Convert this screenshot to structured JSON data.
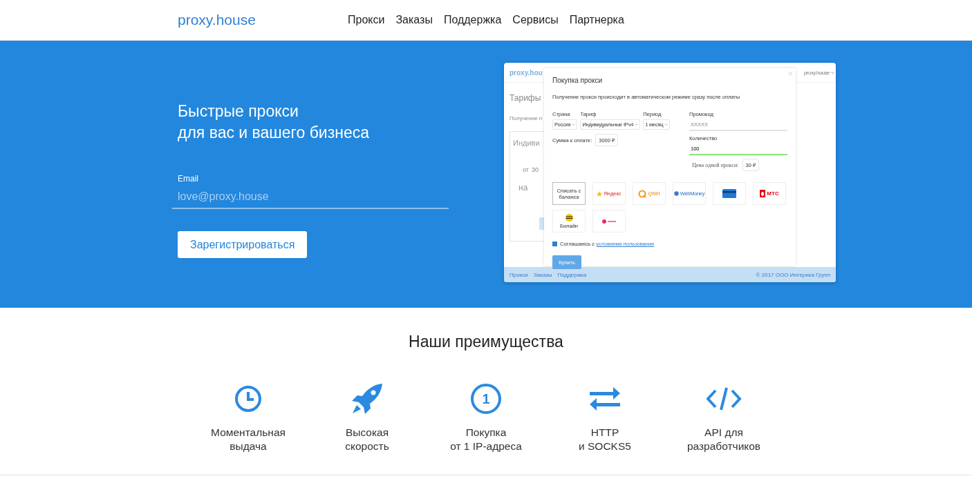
{
  "header": {
    "logo": "proxy.house",
    "nav": [
      {
        "label": "Прокси"
      },
      {
        "label": "Заказы"
      },
      {
        "label": "Поддержка"
      },
      {
        "label": "Сервисы"
      },
      {
        "label": "Партнерка"
      }
    ]
  },
  "hero": {
    "title_lines": [
      "Быстрые прокси",
      "для вас и вашего бизнеса"
    ],
    "email": {
      "label": "Email",
      "placeholder": "love@proxy.house"
    },
    "button": "Зарегистрироваться",
    "preview": {
      "page": {
        "logo": "proxy.hou",
        "user": "proxy.house",
        "heading": "Тарифы",
        "intro": "Получение п",
        "card_title": "Индиви",
        "card_from": "от",
        "card_price": "30",
        "card_button": "на",
        "footer_links": [
          "Прокси",
          "Заказы",
          "Поддержка"
        ],
        "copyright": "© 2017 ООО Интерика Групп"
      },
      "modal": {
        "title": "Покупка прокси",
        "note": "Получение прокси происходит в автоматическом режиме сразу после оплаты",
        "selects": [
          {
            "label": "Страна",
            "value": "Россия"
          },
          {
            "label": "Тариф",
            "value": "Индивидуальные IPv4"
          },
          {
            "label": "Период",
            "value": "1 месяц"
          }
        ],
        "sum_label": "Сумма к оплате:",
        "sum": "3000 ₽",
        "promo": {
          "label": "Промокод",
          "placeholder": "XXXXX"
        },
        "quantity": {
          "label": "Количество",
          "value": "100",
          "valid": true
        },
        "unit_price_label": "Цена одной прокси:",
        "unit_price": "30 ₽",
        "payments": [
          {
            "kind": "balance",
            "label": "Списать с баланса",
            "selected": true
          },
          {
            "kind": "yandex",
            "label": "Яндекс",
            "selected": false
          },
          {
            "kind": "qiwi",
            "label": "QIWI",
            "selected": false
          },
          {
            "kind": "webmoney",
            "label": "WebMoney",
            "selected": false
          },
          {
            "kind": "card",
            "selected": false
          },
          {
            "kind": "mts",
            "label": "МТС",
            "selected": false
          },
          {
            "kind": "beeline",
            "label": "Билайн",
            "selected": false
          },
          {
            "kind": "dot",
            "selected": false
          }
        ],
        "agree": {
          "checked": true,
          "text": "Соглашаюсь с",
          "link": "условиями пользования"
        },
        "buy": "Купить"
      }
    }
  },
  "features": {
    "title": "Наши преимущества",
    "items": [
      {
        "kind": "clock",
        "lines": [
          "Моментальная",
          "выдача"
        ]
      },
      {
        "kind": "rocket",
        "lines": [
          "Высокая",
          "скорость"
        ]
      },
      {
        "kind": "number",
        "icon_text": "1",
        "lines": [
          "Покупка",
          "от 1 IP-адреса"
        ]
      },
      {
        "kind": "arrows",
        "lines": [
          "HTTP",
          "и SOCKS5"
        ]
      },
      {
        "kind": "code",
        "lines": [
          "API для",
          "разработчиков"
        ]
      }
    ]
  }
}
